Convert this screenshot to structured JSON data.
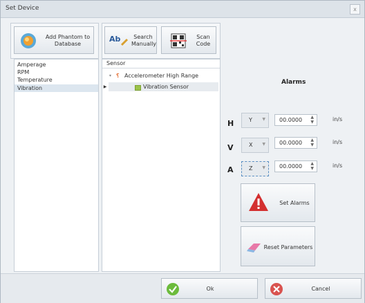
{
  "window": {
    "title": "Set Device",
    "close_glyph": "x"
  },
  "buttons": {
    "add_phantom": "Add Phantom to Database",
    "search_manually": "Search Manually",
    "scan_code": "Scan Code",
    "set_alarms": "Set Alarms",
    "reset_parameters": "Reset Parameters",
    "ok": "Ok",
    "cancel": "Cancel"
  },
  "categories": [
    "Amperage",
    "RPM",
    "Temperature",
    "Vibration"
  ],
  "selected_category": "Vibration",
  "sensor_grid": {
    "header": "Sensor",
    "group": "Accelerometer High Range",
    "child": "Vibration Sensor"
  },
  "alarms": {
    "title": "Alarms",
    "rows": [
      {
        "axis": "H",
        "selection": "Y",
        "value": "00.0000",
        "unit": "in/s"
      },
      {
        "axis": "V",
        "selection": "X",
        "value": "00.0000",
        "unit": "in/s"
      },
      {
        "axis": "A",
        "selection": "Z",
        "value": "00.0000",
        "unit": "in/s"
      }
    ]
  },
  "colors": {
    "accent": "#4a90c8",
    "warning": "#d32f2f",
    "ok_green": "#6cbb3c",
    "cancel_red": "#d9534f"
  }
}
